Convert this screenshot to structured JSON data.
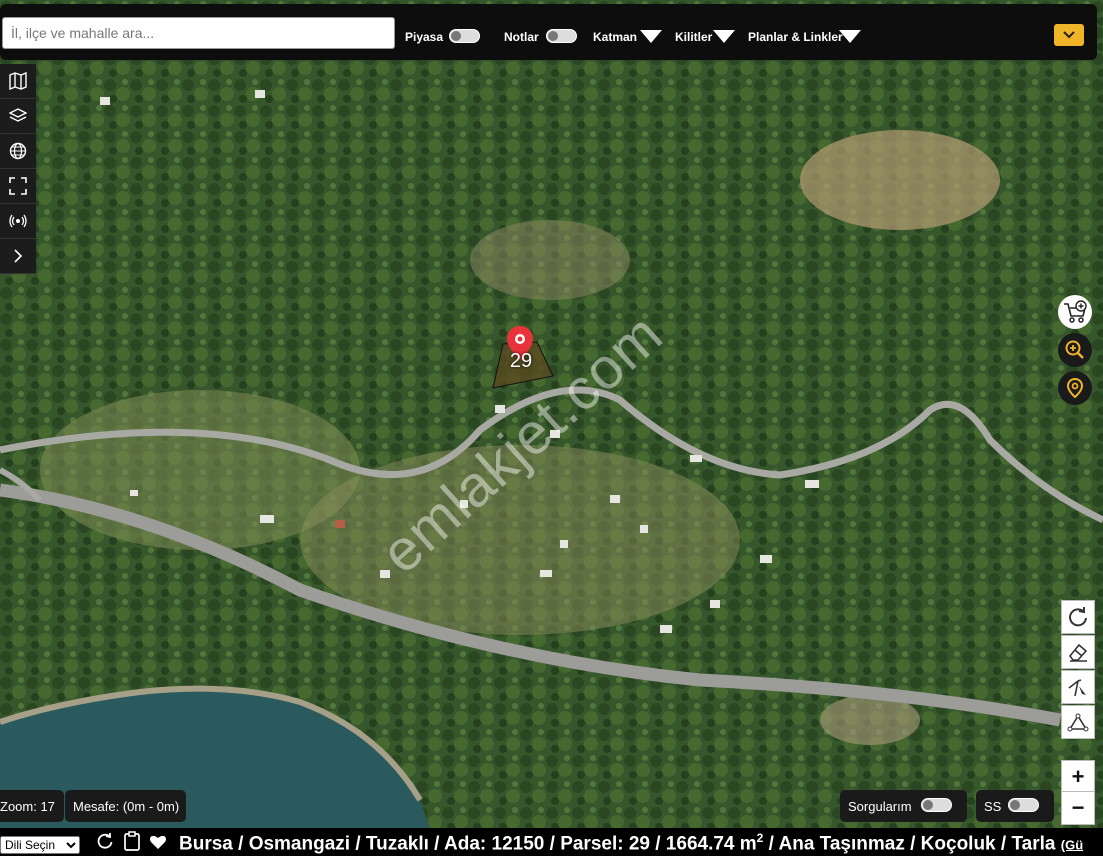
{
  "search": {
    "placeholder": "İl, ilçe ve mahalle ara..."
  },
  "topbar": {
    "piyasa_label": "Piyasa",
    "notlar_label": "Notlar",
    "katman_label": "Katman",
    "kilitler_label": "Kilitler",
    "planlar_label": "Planlar & Linkler"
  },
  "sidebar": {
    "icons": [
      "map-icon",
      "layers-icon",
      "globe-icon",
      "fullscreen-icon",
      "broadcast-icon",
      "chevron-right-icon"
    ]
  },
  "marker": {
    "label": "29"
  },
  "watermark": {
    "text": "emlakjet.com"
  },
  "status": {
    "zoom": "Zoom: 17",
    "distance": "Mesafe: (0m - 0m)",
    "sorgularim_label": "Sorgularım",
    "ss_label": "SS"
  },
  "zoom_controls": {
    "plus": "+",
    "minus": "−"
  },
  "language_select": {
    "selected": "Dili Seçin"
  },
  "parcel": {
    "before_sup": "Bursa / Osmangazi / Tuzaklı / Ada: 12150 / Parsel: 29 / 1664.74 m",
    "sup": "2",
    "after_sup": " / Ana Taşınmaz / Koçoluk / Tarla ",
    "gu": "(Gü"
  },
  "colors": {
    "accent": "#f0b429",
    "marker": "#e8333a",
    "panel": "#0d0d0d"
  }
}
